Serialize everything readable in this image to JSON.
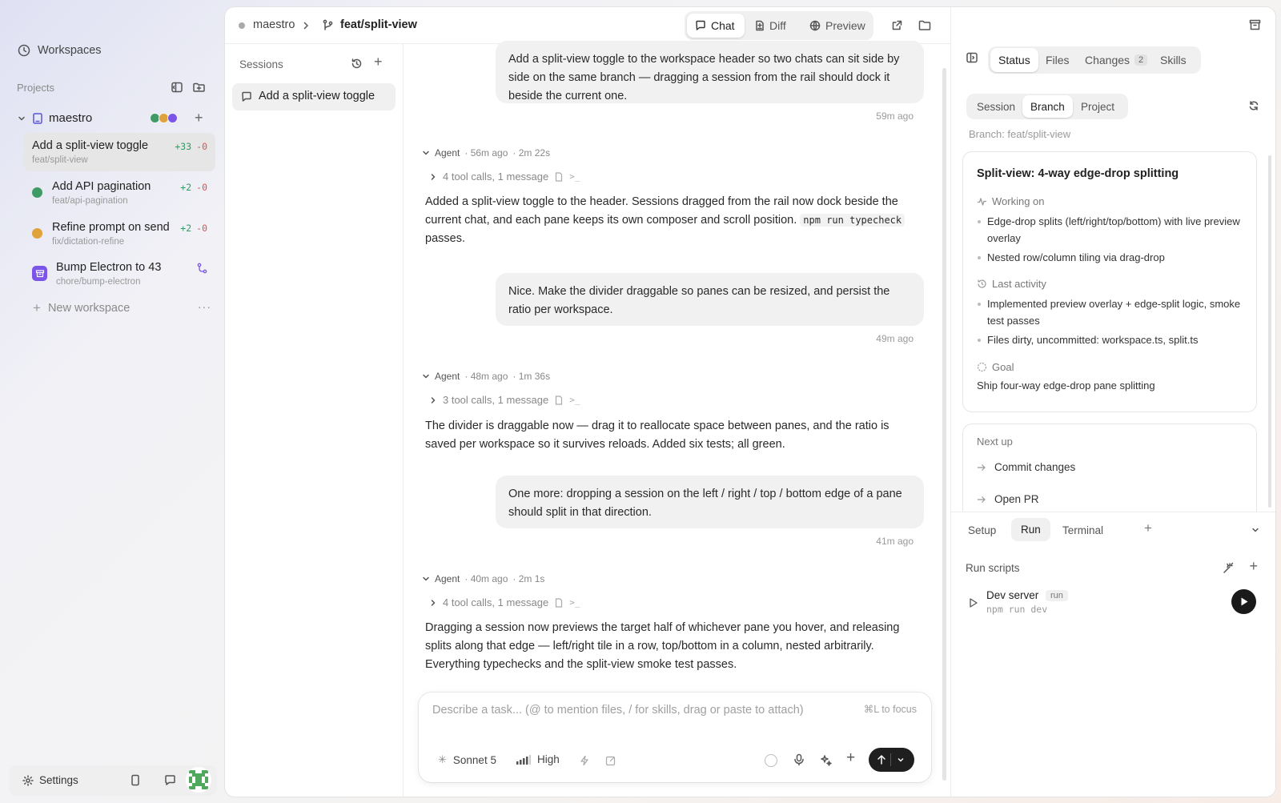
{
  "sidebar": {
    "workspaces_label": "Workspaces",
    "projects_label": "Projects",
    "project_name": "maestro",
    "project_dot_colors": [
      "#3f9b66",
      "#e0a23a",
      "#7a55e8"
    ],
    "workspaces": [
      {
        "title": "Add a split-view toggle",
        "branch": "feat/split-view",
        "plus": "+33",
        "minus": "-0"
      },
      {
        "title": "Add API pagination",
        "branch": "feat/api-pagination",
        "plus": "+2",
        "minus": "-0",
        "status_color": "#3f9b66"
      },
      {
        "title": "Refine prompt on send",
        "branch": "fix/dictation-refine",
        "plus": "+2",
        "minus": "-0",
        "status_color": "#e0a23a"
      },
      {
        "title": "Bump Electron to 43",
        "branch": "chore/bump-electron",
        "status_color": "#7a55e8"
      }
    ],
    "new_workspace_label": "New workspace",
    "settings_label": "Settings"
  },
  "topbar": {
    "repo": "maestro",
    "branch": "feat/split-view",
    "tabs": [
      "Chat",
      "Diff",
      "Preview"
    ]
  },
  "sessions": {
    "title": "Sessions",
    "items": [
      "Add a split-view toggle"
    ]
  },
  "chat": {
    "user_messages": [
      {
        "text": "Add a split-view toggle to the workspace header so two chats can sit side by side on the same branch — dragging a session from the rail should dock it beside the current one.",
        "time": "59m ago"
      },
      {
        "text": "Nice. Make the divider draggable so panes can be resized, and persist the ratio per workspace.",
        "time": "49m ago"
      },
      {
        "text": "One more: dropping a session on the left / right / top / bottom edge of a pane should split in that direction.",
        "time": "41m ago"
      }
    ],
    "agent_turns": [
      {
        "label": "Agent",
        "ago": "· 56m ago",
        "duration": "· 2m 22s",
        "tools": "4 tool calls, 1 message",
        "text_before": "Added a split-view toggle to the header. Sessions dragged from the rail now dock beside the current chat, and each pane keeps its own composer and scroll position.",
        "code": "npm run typecheck",
        "text_after": "passes."
      },
      {
        "label": "Agent",
        "ago": "· 48m ago",
        "duration": "· 1m 36s",
        "tools": "3 tool calls, 1 message",
        "text": "The divider is draggable now — drag it to reallocate space between panes, and the ratio is saved per workspace so it survives reloads. Added six tests; all green."
      },
      {
        "label": "Agent",
        "ago": "· 40m ago",
        "duration": "· 2m 1s",
        "tools": "4 tool calls, 1 message",
        "text": "Dragging a session now previews the target half of whichever pane you hover, and releasing splits along that edge — left/right tile in a row, top/bottom in a column, nested arbitrarily. Everything typechecks and the split-view smoke test passes."
      }
    ]
  },
  "composer": {
    "placeholder": "Describe a task... (@ to mention files, / for skills, drag or paste to attach)",
    "focus_hint": "⌘L to focus",
    "model": "Sonnet 5",
    "effort": "High"
  },
  "right": {
    "tabs": [
      {
        "label": "Status"
      },
      {
        "label": "Files"
      },
      {
        "label": "Changes",
        "badge": "2"
      },
      {
        "label": "Skills"
      }
    ],
    "scope_tabs": [
      "Session",
      "Branch",
      "Project"
    ],
    "branch_label": "Branch: feat/split-view",
    "card_title": "Split-view: 4-way edge-drop splitting",
    "working_on_label": "Working on",
    "working_on": [
      "Edge-drop splits (left/right/top/bottom) with live preview overlay",
      "Nested row/column tiling via drag-drop"
    ],
    "last_activity_label": "Last activity",
    "last_activity": [
      "Implemented preview overlay + edge-split logic, smoke test passes",
      "Files dirty, uncommitted: workspace.ts, split.ts"
    ],
    "goal_label": "Goal",
    "goal": "Ship four-way edge-drop pane splitting",
    "next_up_label": "Next up",
    "next_up": [
      "Commit changes",
      "Open PR"
    ],
    "bottom_tabs": [
      "Setup",
      "Run",
      "Terminal"
    ],
    "run_scripts_label": "Run scripts",
    "script_name": "Dev server",
    "script_tag": "run",
    "script_cmd": "npm run dev"
  }
}
